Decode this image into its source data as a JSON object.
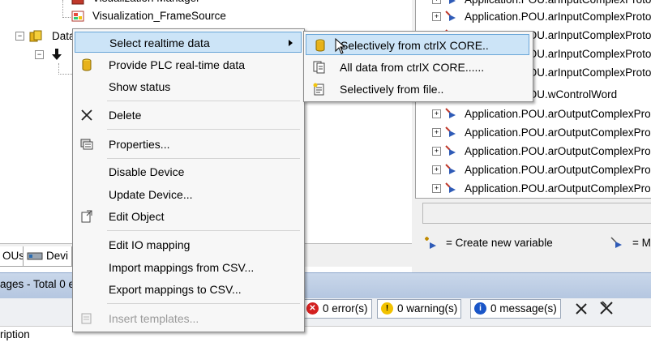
{
  "tree": {
    "items": [
      {
        "label": "Visualization Manager"
      },
      {
        "label": "Visualization_FrameSource"
      },
      {
        "label": "Data"
      }
    ]
  },
  "bottom_tabs": [
    {
      "label": "OUs"
    },
    {
      "label": "Devi"
    }
  ],
  "messages": {
    "title": "ages - Total 0 e",
    "errors": "0 error(s)",
    "warnings": "0 warning(s)",
    "messages": "0 message(s)",
    "description_header": "ription"
  },
  "context_menu": {
    "items": [
      {
        "label": "Select realtime data",
        "icon": "none",
        "submenu": true
      },
      {
        "label": "Provide PLC real-time data",
        "icon": "database-icon"
      },
      {
        "label": "Show status",
        "icon": "none"
      },
      {
        "label": "Delete",
        "icon": "delete-x-icon"
      },
      {
        "label": "Properties...",
        "icon": "properties-icon"
      },
      {
        "label": "Disable Device",
        "icon": "none"
      },
      {
        "label": "Update Device...",
        "icon": "none"
      },
      {
        "label": "Edit Object",
        "icon": "edit-object-icon"
      },
      {
        "label": "Edit IO mapping",
        "icon": "none"
      },
      {
        "label": "Import mappings from CSV...",
        "icon": "none"
      },
      {
        "label": "Export mappings to CSV...",
        "icon": "none"
      },
      {
        "label": "Insert templates...",
        "icon": "template-icon",
        "disabled": true
      }
    ]
  },
  "submenu": {
    "items": [
      {
        "label": "Selectively from ctrlX CORE..",
        "icon": "database-icon"
      },
      {
        "label": "All data from ctrlX CORE......",
        "icon": "document-stack-icon"
      },
      {
        "label": "Selectively from file..",
        "icon": "file-icon"
      }
    ]
  },
  "variable_list": {
    "rows": [
      {
        "label": "Application.POU.arInputComplexProto"
      },
      {
        "label": "Application.POU.arInputComplexProto"
      },
      {
        "label": "Application.POU.arInputComplexProto"
      },
      {
        "label": "Application.POU.arInputComplexProto"
      },
      {
        "label": "Application.POU.arInputComplexProto"
      },
      {
        "label": "Application.POU.wControlWord"
      },
      {
        "label": "Application.POU.arOutputComplexPro"
      },
      {
        "label": "Application.POU.arOutputComplexPro"
      },
      {
        "label": "Application.POU.arOutputComplexPro"
      },
      {
        "label": "Application.POU.arOutputComplexPro"
      },
      {
        "label": "Application.POU.arOutputComplexPro"
      },
      {
        "label": "Application.POU.arOutputComplexPro"
      }
    ],
    "legend_create": "= Create new variable",
    "legend_map": "= M"
  },
  "colors": {
    "highlight": "#cce4f7",
    "highlight_border": "#6aa6d8",
    "message_bar": "#b4c6e0",
    "error": "#d32020",
    "warning": "#f2c200",
    "info": "#1a56c8"
  }
}
